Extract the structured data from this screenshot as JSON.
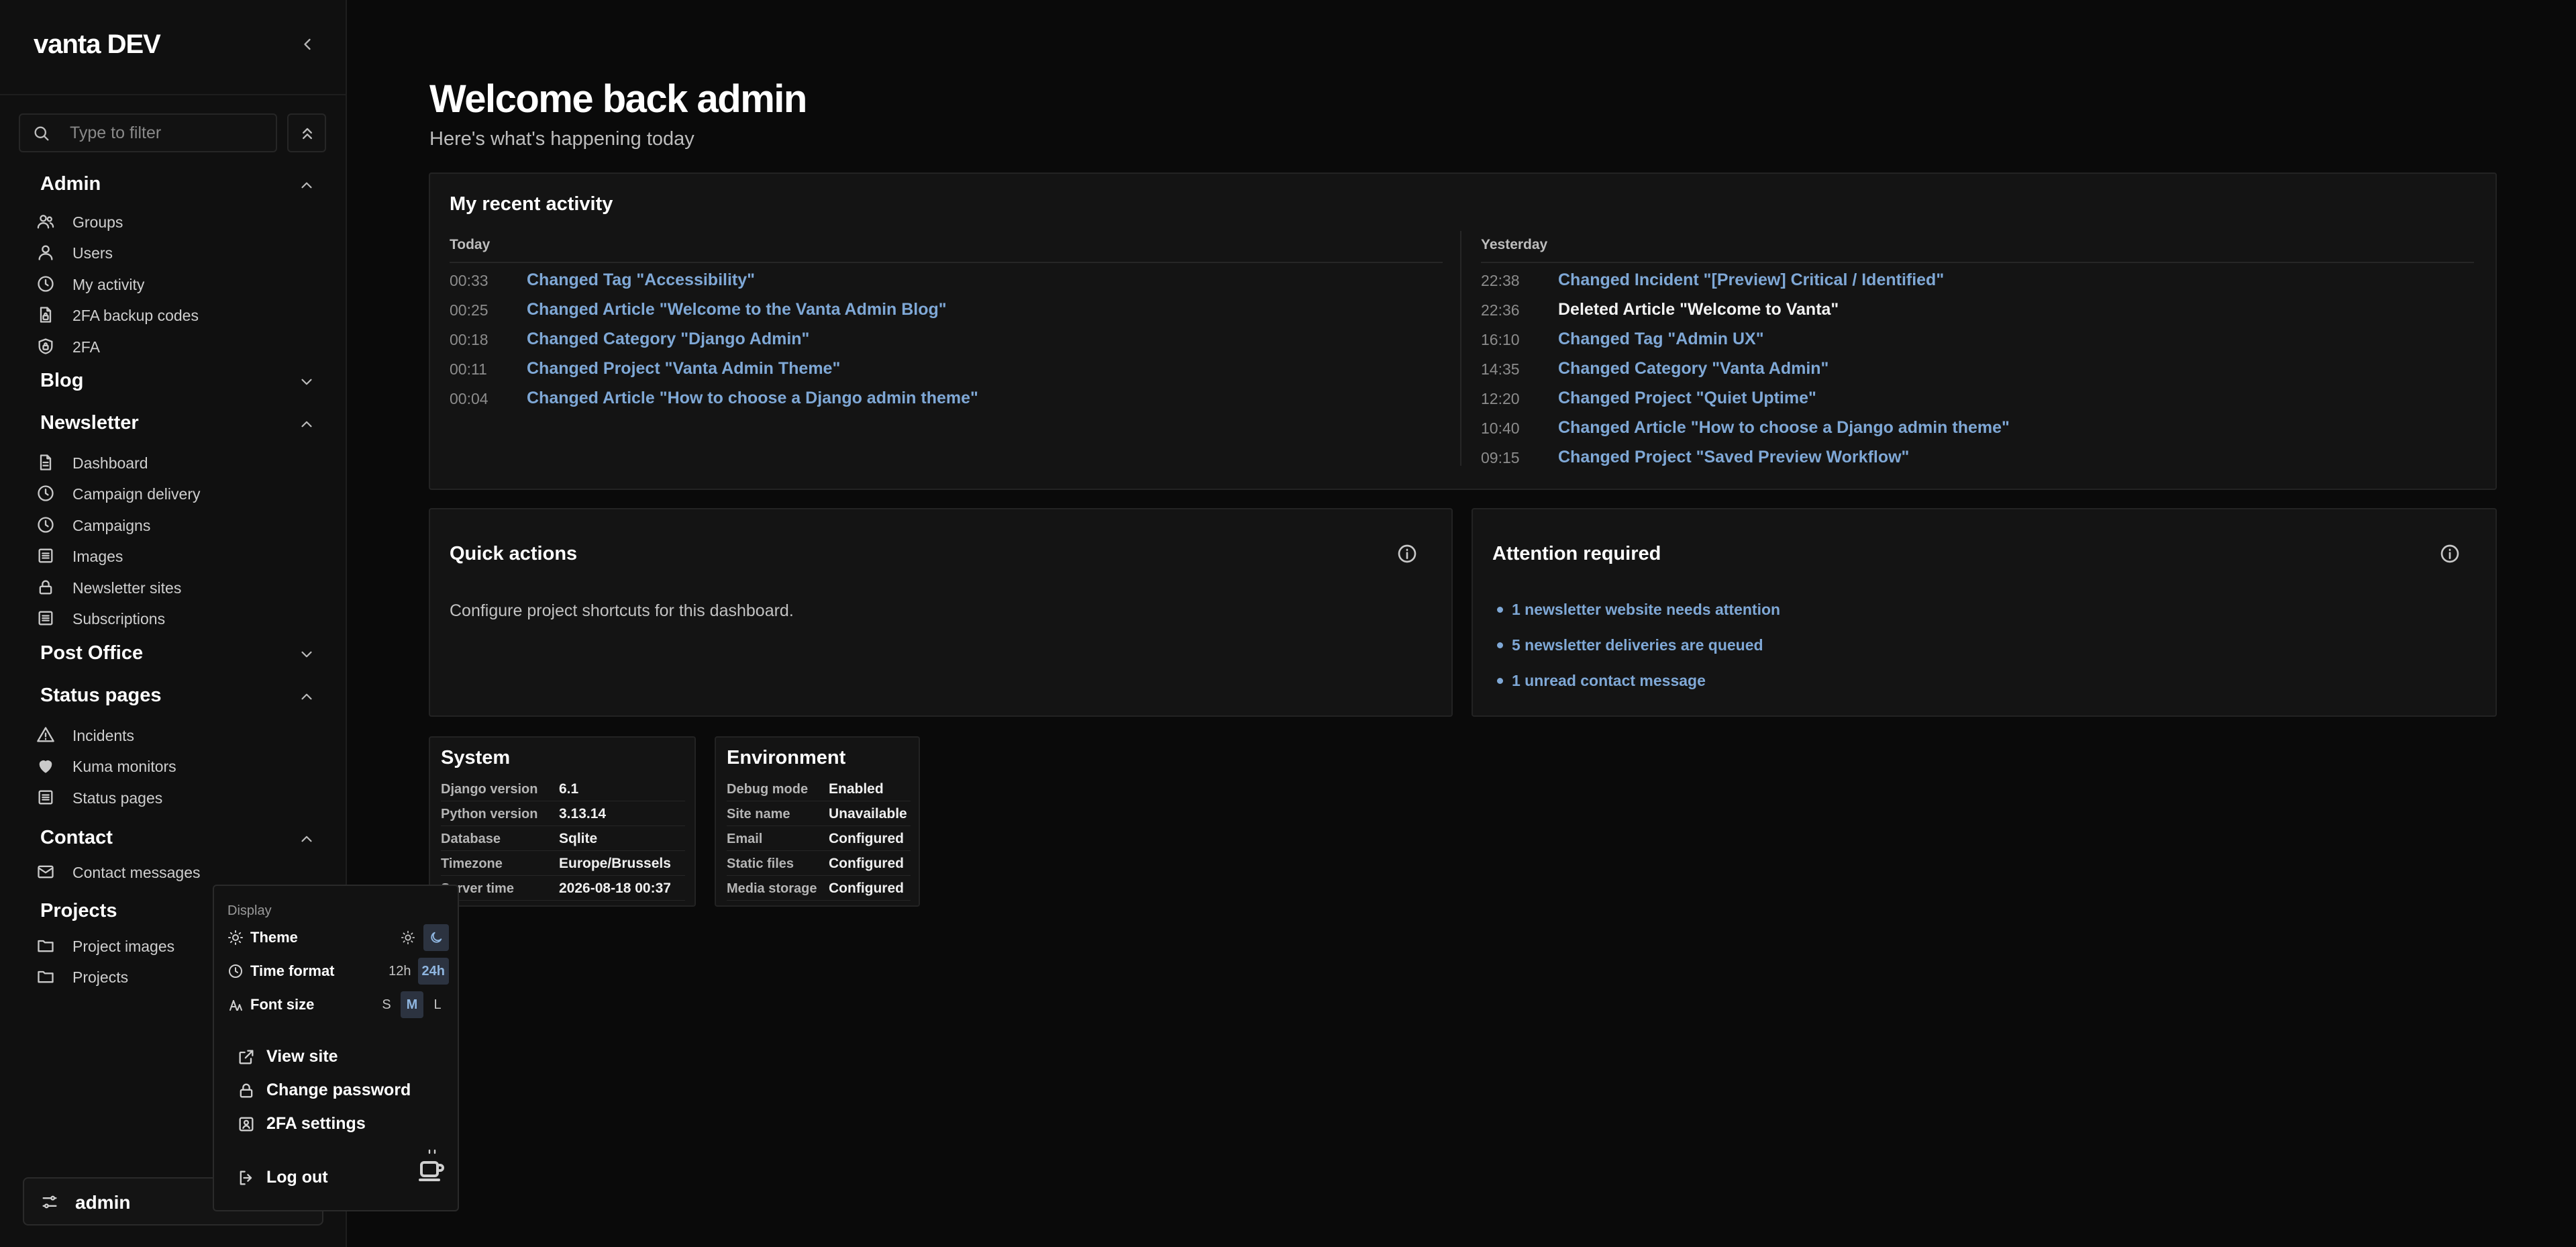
{
  "sidebar": {
    "brand": "vanta DEV",
    "filter_placeholder": "Type to filter",
    "groups": [
      {
        "title": "Admin",
        "expanded": true,
        "items": [
          {
            "label": "Groups",
            "icon": "users-icon"
          },
          {
            "label": "Users",
            "icon": "user-icon"
          },
          {
            "label": "My activity",
            "icon": "clock-icon"
          },
          {
            "label": "2FA backup codes",
            "icon": "file-lock-icon"
          },
          {
            "label": "2FA",
            "icon": "shield-lock-icon"
          }
        ]
      },
      {
        "title": "Blog",
        "expanded": false,
        "items": []
      },
      {
        "title": "Newsletter",
        "expanded": true,
        "items": [
          {
            "label": "Dashboard",
            "icon": "file-icon"
          },
          {
            "label": "Campaign delivery",
            "icon": "clock-icon"
          },
          {
            "label": "Campaigns",
            "icon": "clock-icon"
          },
          {
            "label": "Images",
            "icon": "list-icon"
          },
          {
            "label": "Newsletter sites",
            "icon": "lock-icon"
          },
          {
            "label": "Subscriptions",
            "icon": "list-icon"
          }
        ]
      },
      {
        "title": "Post Office",
        "expanded": false,
        "items": []
      },
      {
        "title": "Status pages",
        "expanded": true,
        "items": [
          {
            "label": "Incidents",
            "icon": "warning-icon"
          },
          {
            "label": "Kuma monitors",
            "icon": "heart-icon"
          },
          {
            "label": "Status pages",
            "icon": "list-icon"
          }
        ]
      },
      {
        "title": "Contact",
        "expanded": true,
        "items": [
          {
            "label": "Contact messages",
            "icon": "mail-icon"
          }
        ]
      },
      {
        "title": "Projects",
        "expanded": true,
        "items": [
          {
            "label": "Project images",
            "icon": "folder-icon"
          },
          {
            "label": "Projects",
            "icon": "folder-icon"
          }
        ]
      }
    ],
    "user_label": "admin"
  },
  "main": {
    "welcome": "Welcome back admin",
    "subtitle": "Here's what's happening today"
  },
  "activity": {
    "title": "My recent activity",
    "today_label": "Today",
    "yesterday_label": "Yesterday",
    "today": [
      {
        "time": "00:33",
        "action": "Changed Tag \"Accessibility\"",
        "link": true
      },
      {
        "time": "00:25",
        "action": "Changed Article \"Welcome to the Vanta Admin Blog\"",
        "link": true
      },
      {
        "time": "00:18",
        "action": "Changed Category \"Django Admin\"",
        "link": true
      },
      {
        "time": "00:11",
        "action": "Changed Project \"Vanta Admin Theme\"",
        "link": true
      },
      {
        "time": "00:04",
        "action": "Changed Article \"How to choose a Django admin theme\"",
        "link": true
      }
    ],
    "yesterday": [
      {
        "time": "22:38",
        "action": "Changed Incident \"[Preview] Critical / Identified\"",
        "link": true
      },
      {
        "time": "22:36",
        "action": "Deleted Article \"Welcome to Vanta\"",
        "link": false
      },
      {
        "time": "16:10",
        "action": "Changed Tag \"Admin UX\"",
        "link": true
      },
      {
        "time": "14:35",
        "action": "Changed Category \"Vanta Admin\"",
        "link": true
      },
      {
        "time": "12:20",
        "action": "Changed Project \"Quiet Uptime\"",
        "link": true
      },
      {
        "time": "10:40",
        "action": "Changed Article \"How to choose a Django admin theme\"",
        "link": true
      },
      {
        "time": "09:15",
        "action": "Changed Project \"Saved Preview Workflow\"",
        "link": true
      }
    ]
  },
  "quick_actions": {
    "title": "Quick actions",
    "description": "Configure project shortcuts for this dashboard."
  },
  "attention": {
    "title": "Attention required",
    "items": [
      "1 newsletter website needs attention",
      "5 newsletter deliveries are queued",
      "1 unread contact message"
    ]
  },
  "system": {
    "title": "System",
    "rows": [
      {
        "key": "Django version",
        "value": "6.1"
      },
      {
        "key": "Python version",
        "value": "3.13.14"
      },
      {
        "key": "Database",
        "value": "Sqlite"
      },
      {
        "key": "Timezone",
        "value": "Europe/Brussels"
      },
      {
        "key": "Server time",
        "value": "2026-08-18 00:37"
      }
    ]
  },
  "environment": {
    "title": "Environment",
    "rows": [
      {
        "key": "Debug mode",
        "value": "Enabled"
      },
      {
        "key": "Site name",
        "value": "Unavailable"
      },
      {
        "key": "Email",
        "value": "Configured"
      },
      {
        "key": "Static files",
        "value": "Configured"
      },
      {
        "key": "Media storage",
        "value": "Configured"
      }
    ]
  },
  "popup": {
    "display_label": "Display",
    "theme_label": "Theme",
    "theme_selected": "dark",
    "time_format_label": "Time format",
    "time_format_options": [
      "12h",
      "24h"
    ],
    "time_format_selected": "24h",
    "font_size_label": "Font size",
    "font_size_options": [
      "S",
      "M",
      "L"
    ],
    "font_size_selected": "M",
    "menu": [
      {
        "label": "View site",
        "icon": "external-link-icon"
      },
      {
        "label": "Change password",
        "icon": "lock-icon"
      },
      {
        "label": "2FA settings",
        "icon": "shield-id-icon"
      }
    ],
    "logout_label": "Log out"
  },
  "colors": {
    "background": "#0a0a0a",
    "panel": "#141414",
    "link": "#7fa8d6",
    "selected_toggle": "#2c3340"
  }
}
